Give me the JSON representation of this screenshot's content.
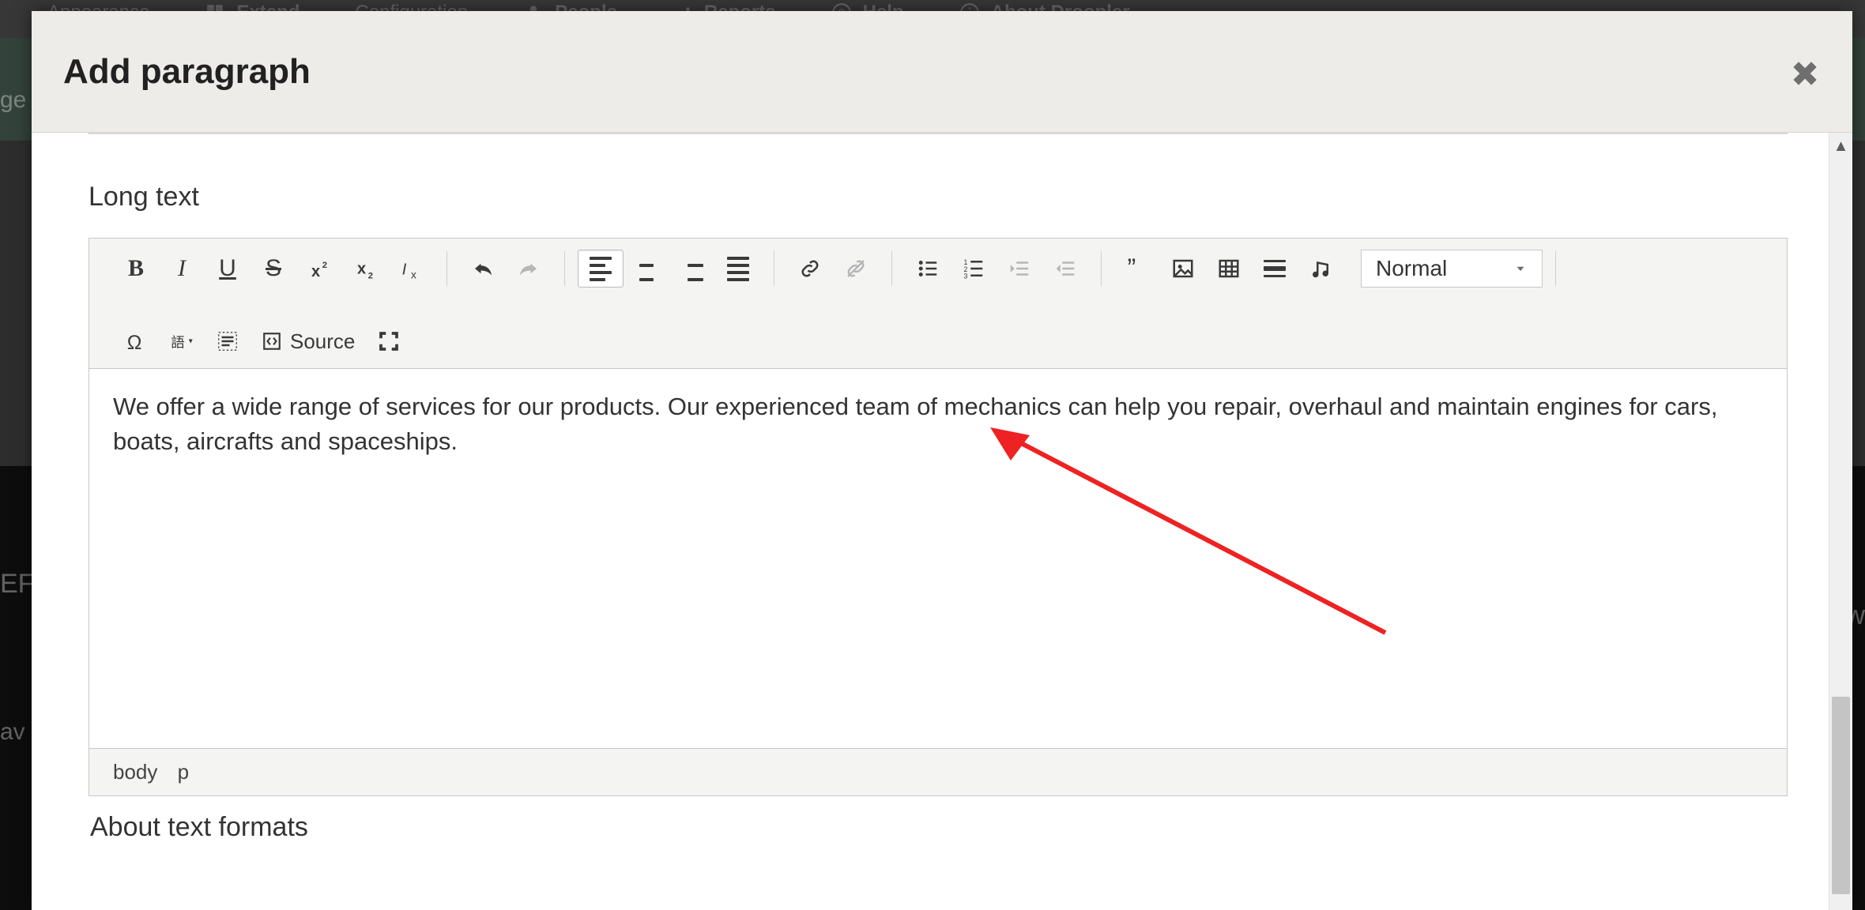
{
  "admin_nav": {
    "appearance": "Appearance",
    "extend": "Extend",
    "configuration": "Configuration",
    "people": "People",
    "reports": "Reports",
    "help": "Help",
    "about": "About Droopler"
  },
  "bg_fragments": {
    "ge": "ge",
    "er": "EF",
    "ow": "ow",
    "av": "av"
  },
  "modal": {
    "title": "Add paragraph",
    "section_label": "Long text",
    "content_text": "We offer a wide range of services for our products. Our experienced team of mechanics can help you repair, overhaul and maintain engines for cars, boats, aircrafts and spaceships.",
    "format_value": "Normal",
    "source_label": "Source",
    "path": {
      "body": "body",
      "p": "p"
    },
    "about_formats": "About text formats"
  }
}
